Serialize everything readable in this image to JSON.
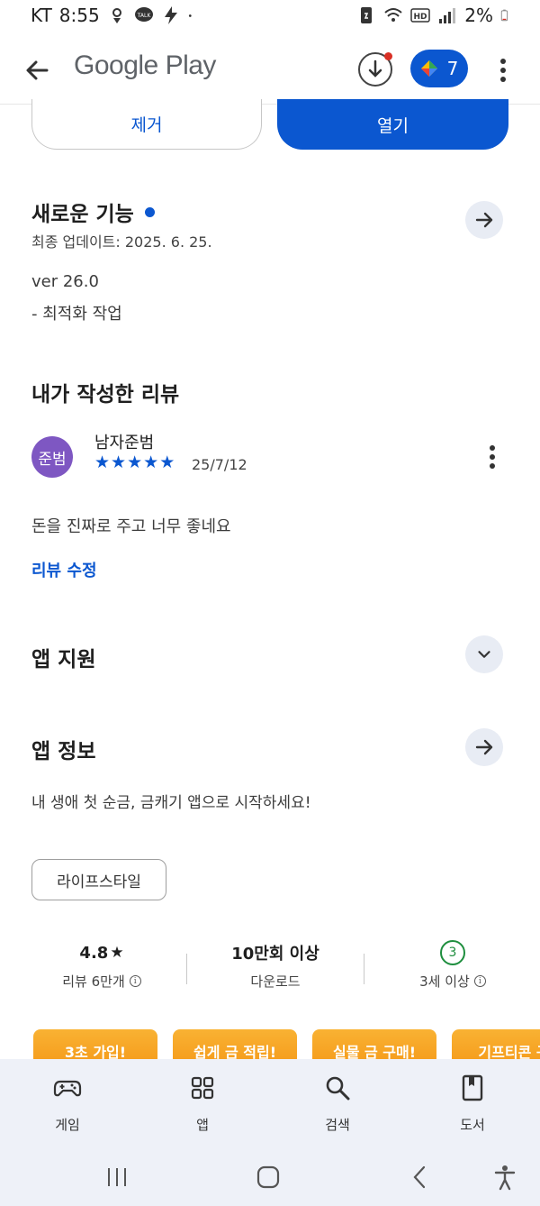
{
  "status_bar": {
    "carrier": "KT",
    "time": "8:55",
    "battery": "2%"
  },
  "top_bar": {
    "logo": "Google Play",
    "points_count": "7"
  },
  "actions": {
    "remove": "제거",
    "open": "열기"
  },
  "whats_new": {
    "title": "새로운 기능",
    "updated": "최종 업데이트: 2025. 6. 25.",
    "version": "ver 26.0",
    "note": "- 최적화 작업"
  },
  "my_review": {
    "title": "내가 작성한 리뷰",
    "avatar_text": "준범",
    "reviewer": "남자준범",
    "stars": [
      "★",
      "★",
      "★",
      "★",
      "★"
    ],
    "rating": 5,
    "date": "25/7/12",
    "text": "돈을 진짜로 주고 너무 좋네요",
    "edit_label": "리뷰 수정"
  },
  "app_support": {
    "title": "앱 지원"
  },
  "app_info": {
    "title": "앱 정보",
    "description": "내 생애 첫 순금, 금캐기 앱으로 시작하세요!",
    "category": "라이프스타일"
  },
  "stats": {
    "rating": "4.8",
    "rating_star": "★",
    "reviews": "리뷰 6만개",
    "downloads": "10만회 이상",
    "downloads_label": "다운로드",
    "age": "3",
    "age_label": "3세 이상",
    "info_glyph": "i"
  },
  "promos": [
    "3초 가입!",
    "쉽게 금 적립!",
    "실물 금 구매!",
    "기프티콘 구"
  ],
  "bottom_nav": {
    "games": "게임",
    "apps": "앱",
    "search": "검색",
    "books": "도서"
  },
  "colors": {
    "accent": "#0b57d0",
    "avatar": "#7e57c2",
    "age_green": "#1e8e3e",
    "promo": "#f5a623"
  },
  "icons": [
    "back-arrow-icon",
    "download-icon",
    "points-diamond-icon",
    "more-vert-icon",
    "arrow-forward-icon",
    "chevron-down-icon",
    "star-icon",
    "info-icon",
    "gamepad-icon",
    "apps-grid-icon",
    "search-icon",
    "book-icon"
  ]
}
